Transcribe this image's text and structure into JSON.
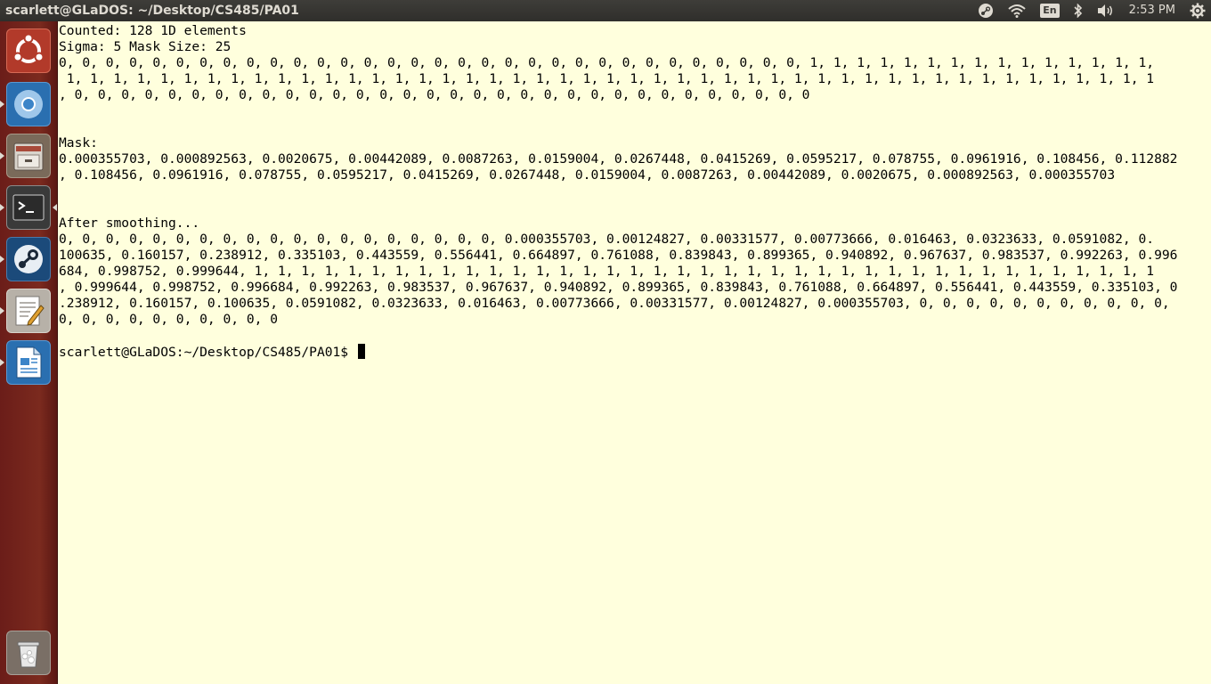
{
  "window": {
    "title": "scarlett@GLaDOS: ~/Desktop/CS485/PA01"
  },
  "indicators": {
    "icons": [
      "steam-icon",
      "wifi-icon",
      "keyboard-layout-icon",
      "bluetooth-icon",
      "volume-icon",
      "settings-gear-icon"
    ],
    "keyboard_layout": "En",
    "clock": "2:53 PM"
  },
  "launcher": {
    "items": [
      {
        "name": "dash-home",
        "icon": "ubuntu-logo-icon"
      },
      {
        "name": "chromium",
        "icon": "chromium-icon"
      },
      {
        "name": "files",
        "icon": "file-cabinet-icon"
      },
      {
        "name": "terminal",
        "icon": "terminal-icon"
      },
      {
        "name": "steam",
        "icon": "steam-icon"
      },
      {
        "name": "text-editor",
        "icon": "text-editor-icon"
      },
      {
        "name": "libreoffice-writer",
        "icon": "writer-document-icon"
      },
      {
        "name": "trash",
        "icon": "trash-icon"
      }
    ]
  },
  "terminal": {
    "lines": [
      "Counted: 128 1D elements",
      "Sigma: 5 Mask Size: 25",
      "0, 0, 0, 0, 0, 0, 0, 0, 0, 0, 0, 0, 0, 0, 0, 0, 0, 0, 0, 0, 0, 0, 0, 0, 0, 0, 0, 0, 0, 0, 0, 0, 1, 1, 1, 1, 1, 1, 1, 1, 1, 1, 1, 1, 1, 1, 1,",
      " 1, 1, 1, 1, 1, 1, 1, 1, 1, 1, 1, 1, 1, 1, 1, 1, 1, 1, 1, 1, 1, 1, 1, 1, 1, 1, 1, 1, 1, 1, 1, 1, 1, 1, 1, 1, 1, 1, 1, 1, 1, 1, 1, 1, 1, 1, 1",
      ", 0, 0, 0, 0, 0, 0, 0, 0, 0, 0, 0, 0, 0, 0, 0, 0, 0, 0, 0, 0, 0, 0, 0, 0, 0, 0, 0, 0, 0, 0, 0, 0",
      "",
      "",
      "Mask:",
      "0.000355703, 0.000892563, 0.0020675, 0.00442089, 0.0087263, 0.0159004, 0.0267448, 0.0415269, 0.0595217, 0.078755, 0.0961916, 0.108456, 0.112882",
      ", 0.108456, 0.0961916, 0.078755, 0.0595217, 0.0415269, 0.0267448, 0.0159004, 0.0087263, 0.00442089, 0.0020675, 0.000892563, 0.000355703",
      "",
      "",
      "After smoothing...",
      "0, 0, 0, 0, 0, 0, 0, 0, 0, 0, 0, 0, 0, 0, 0, 0, 0, 0, 0, 0.000355703, 0.00124827, 0.00331577, 0.00773666, 0.016463, 0.0323633, 0.0591082, 0.",
      "100635, 0.160157, 0.238912, 0.335103, 0.443559, 0.556441, 0.664897, 0.761088, 0.839843, 0.899365, 0.940892, 0.967637, 0.983537, 0.992263, 0.996",
      "684, 0.998752, 0.999644, 1, 1, 1, 1, 1, 1, 1, 1, 1, 1, 1, 1, 1, 1, 1, 1, 1, 1, 1, 1, 1, 1, 1, 1, 1, 1, 1, 1, 1, 1, 1, 1, 1, 1, 1, 1, 1, 1, 1",
      ", 0.999644, 0.998752, 0.996684, 0.992263, 0.983537, 0.967637, 0.940892, 0.899365, 0.839843, 0.761088, 0.664897, 0.556441, 0.443559, 0.335103, 0",
      ".238912, 0.160157, 0.100635, 0.0591082, 0.0323633, 0.016463, 0.00773666, 0.00331577, 0.00124827, 0.000355703, 0, 0, 0, 0, 0, 0, 0, 0, 0, 0, 0,",
      "0, 0, 0, 0, 0, 0, 0, 0, 0, 0",
      ""
    ],
    "prompt": "scarlett@GLaDOS:~/Desktop/CS485/PA01$ "
  },
  "colors": {
    "terminal_background": "#ffffdd",
    "launcher_background": "#7b2a1e",
    "panel_background": "#3a3935"
  }
}
